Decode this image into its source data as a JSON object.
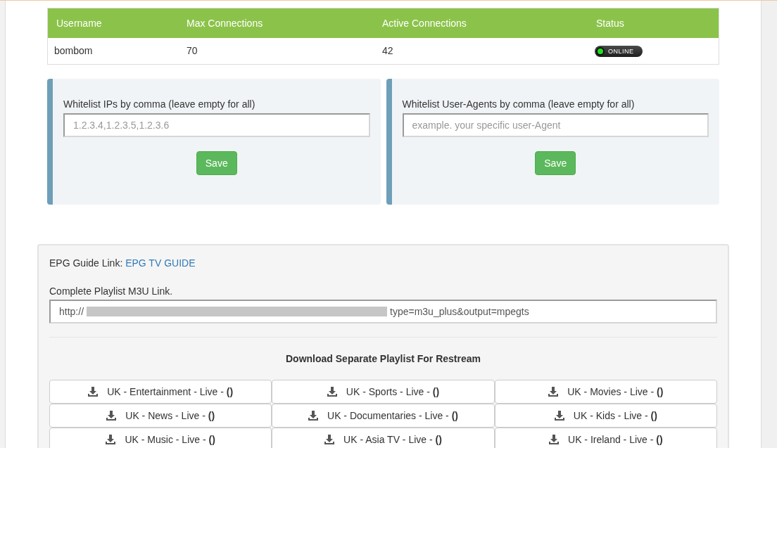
{
  "account_table": {
    "columns": [
      "Username",
      "Max Connections",
      "Active Connections",
      "Status"
    ],
    "rows": [
      {
        "username": "bombom",
        "max_connections": "70",
        "active_connections": "42",
        "status": {
          "label": "ONLINE",
          "online": true
        }
      }
    ]
  },
  "whitelists": [
    {
      "label": "Whitelist IPs by comma (leave empty for all)",
      "placeholder": "1.2.3.4,1.2.3.5,1.2.3.6",
      "button": "Save"
    },
    {
      "label": "Whitelist User-Agents by comma (leave empty for all)",
      "placeholder": "example. your specific user-Agent",
      "button": "Save"
    }
  ],
  "playlist_panel": {
    "epg_label": "EPG Guide Link:",
    "epg_link": "EPG TV GUIDE",
    "m3u_label": "Complete Playlist M3U Link.",
    "m3u_value_start": "http://",
    "m3u_redacted": true,
    "m3u_value_end": "type=m3u_plus&output=mpegts",
    "download_heading": "Download Separate Playlist For Restream",
    "downloads": [
      "UK - Entertainment - Live - **()**",
      "UK - Sports - Live - **()**",
      "UK - Movies - Live - **()**",
      "UK - News - Live - **()**",
      "UK - Documentaries - Live - **()**",
      "UK - Kids - Live - **()**",
      "UK - Music - Live - **()**",
      "UK - Asia TV - Live - **()**",
      "UK - Ireland - Live - **()**"
    ]
  }
}
